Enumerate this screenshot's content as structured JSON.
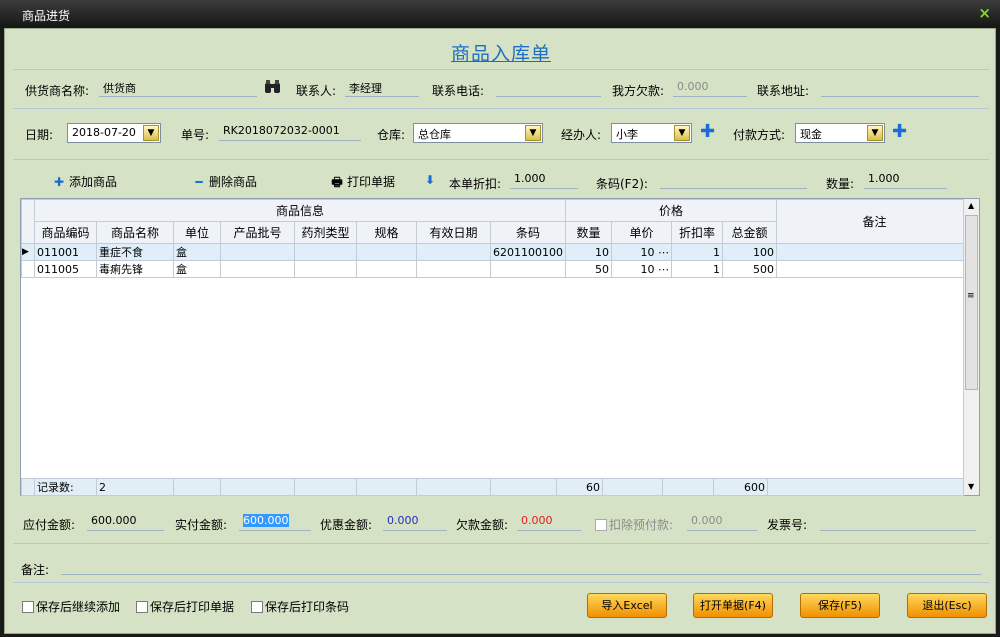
{
  "window": {
    "title": "商品进货",
    "close": "×"
  },
  "form": {
    "heading": "商品入库单"
  },
  "supplier": {
    "name_label": "供货商名称:",
    "name_value": "供货商",
    "contact_label": "联系人:",
    "contact_value": "李经理",
    "phone_label": "联系电话:",
    "phone_value": "",
    "debt_label": "我方欠款:",
    "debt_value": "0.000",
    "address_label": "联系地址:",
    "address_value": ""
  },
  "order": {
    "date_label": "日期:",
    "date_value": "2018-07-20",
    "no_label": "单号:",
    "no_value": "RK2018072032-0001",
    "warehouse_label": "仓库:",
    "warehouse_value": "总仓库",
    "handler_label": "经办人:",
    "handler_value": "小李",
    "payment_label": "付款方式:",
    "payment_value": "现金"
  },
  "toolbar": {
    "add": "添加商品",
    "delete": "删除商品",
    "print": "打印单据",
    "discount_label": "本单折扣:",
    "discount_value": "1.000",
    "barcode_label": "条码(F2):",
    "barcode_value": "",
    "qty_label": "数量:",
    "qty_value": "1.000"
  },
  "grid": {
    "group_info": "商品信息",
    "group_price": "价格",
    "remark_header": "备注",
    "columns": [
      "商品编码",
      "商品名称",
      "单位",
      "产品批号",
      "药剂类型",
      "规格",
      "有效日期",
      "条码",
      "数量",
      "单价",
      "折扣率",
      "总金额"
    ],
    "rows": [
      {
        "code": "011001",
        "name": "重症不食",
        "unit": "盒",
        "batch": "",
        "type": "",
        "spec": "",
        "expiry": "",
        "barcode": "6201100100",
        "qty": "10",
        "price": "10",
        "rate": "1",
        "total": "100",
        "remark": ""
      },
      {
        "code": "011005",
        "name": "毒痢先锋",
        "unit": "盒",
        "batch": "",
        "type": "",
        "spec": "",
        "expiry": "",
        "barcode": "",
        "qty": "50",
        "price": "10",
        "rate": "1",
        "total": "500",
        "remark": ""
      }
    ],
    "footer": {
      "label": "记录数:",
      "count": "2",
      "qty_sum": "60",
      "total_sum": "600"
    }
  },
  "summary": {
    "payable_label": "应付金额:",
    "payable_value": "600.000",
    "paid_label": "实付金额:",
    "paid_value": "600.000",
    "discount_label": "优惠金额:",
    "discount_value": "0.000",
    "owed_label": "欠款金额:",
    "owed_value": "0.000",
    "prepay_label": "扣除预付款:",
    "prepay_value": "0.000",
    "invoice_label": "发票号:",
    "invoice_value": ""
  },
  "remark": {
    "label": "备注:",
    "value": ""
  },
  "options": {
    "continue_add": "保存后继续添加",
    "print_receipt": "保存后打印单据",
    "print_barcode": "保存后打印条码"
  },
  "buttons": {
    "import": "导入Excel",
    "open": "打开单据(F4)",
    "save": "保存(F5)",
    "exit": "退出(Esc)"
  },
  "colors": {
    "accent": "#1f6fc0",
    "window_bg": "#d6e2c6",
    "button": "#f5a623",
    "owed": "#e02020",
    "discount": "#2030c0"
  }
}
